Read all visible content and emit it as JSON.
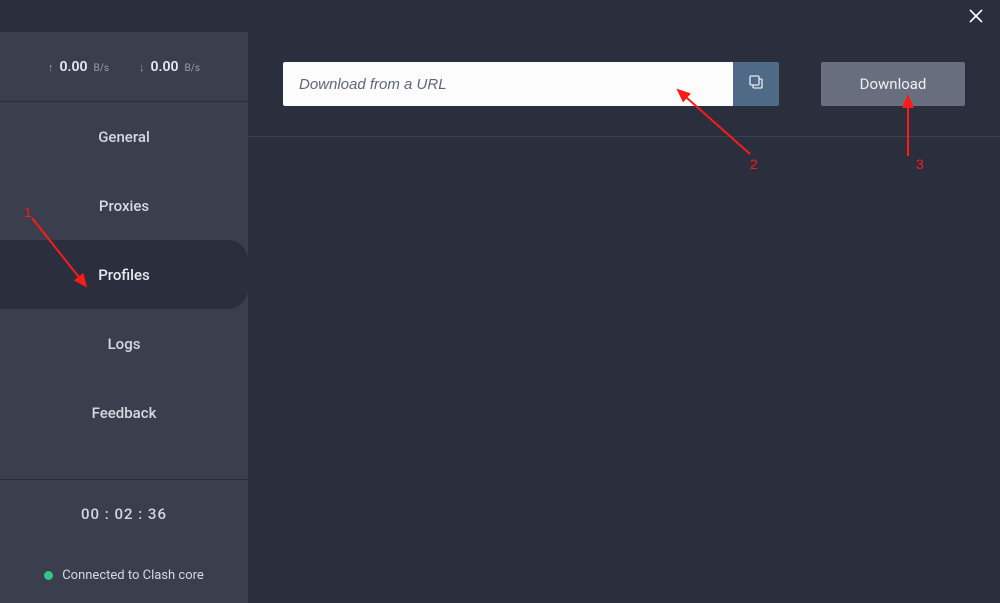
{
  "titlebar": {},
  "stats": {
    "upload": {
      "value": "0.00",
      "unit": "B/s"
    },
    "download": {
      "value": "0.00",
      "unit": "B/s"
    }
  },
  "sidebar": {
    "items": [
      {
        "label": "General",
        "active": false
      },
      {
        "label": "Proxies",
        "active": false
      },
      {
        "label": "Profiles",
        "active": true
      },
      {
        "label": "Logs",
        "active": false
      },
      {
        "label": "Feedback",
        "active": false
      }
    ],
    "uptime": "00 : 02 : 36",
    "status_text": "Connected to Clash core"
  },
  "main": {
    "url_placeholder": "Download from a URL",
    "download_label": "Download"
  },
  "annotations": {
    "a1": "1",
    "a2": "2",
    "a3": "3"
  }
}
